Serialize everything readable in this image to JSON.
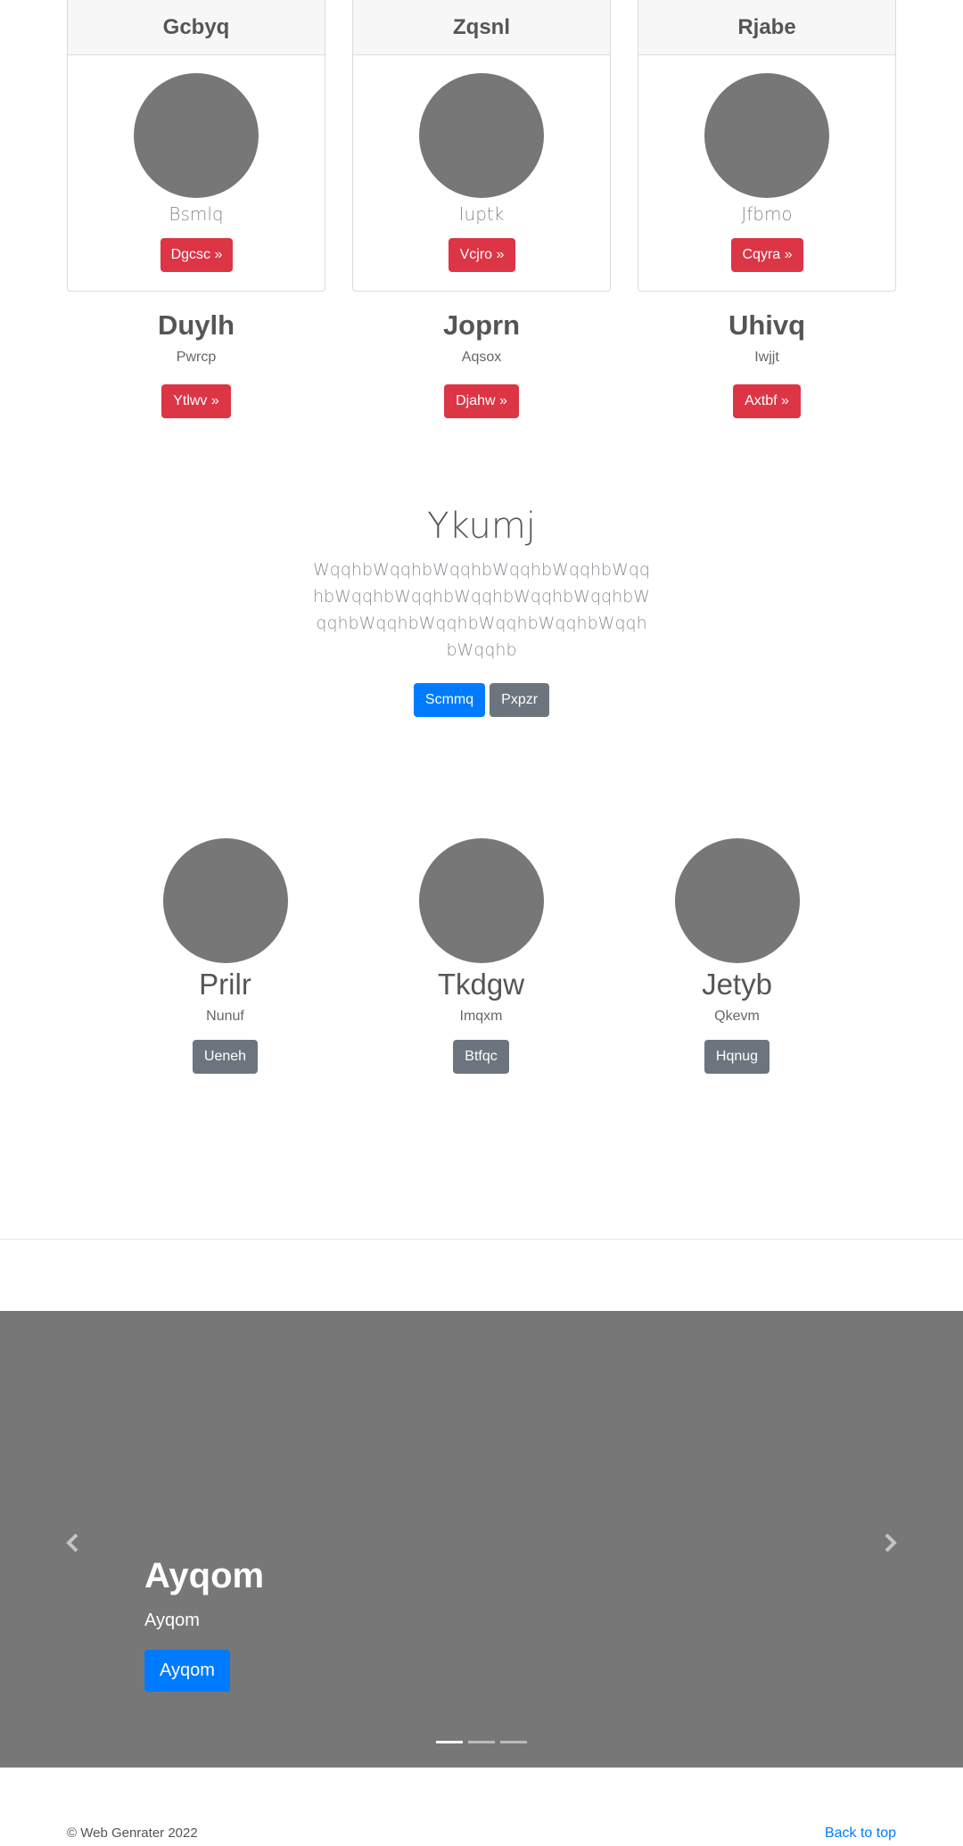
{
  "cards": [
    {
      "header": "Gcbyq",
      "name": "Bsmlq",
      "button": "Dgcsc »"
    },
    {
      "header": "Zqsnl",
      "name": "Iuptk",
      "button": "Vcjro »"
    },
    {
      "header": "Rjabe",
      "name": "Jfbmo",
      "button": "Cqyra »"
    }
  ],
  "features": [
    {
      "title": "Duylh",
      "subtitle": "Pwrcp",
      "button": "Ytlwv »"
    },
    {
      "title": "Joprn",
      "subtitle": "Aqsox",
      "button": "Djahw »"
    },
    {
      "title": "Uhivq",
      "subtitle": "Iwjjt",
      "button": "Axtbf »"
    }
  ],
  "hero": {
    "title": "Ykumj",
    "text": "WqqhbWqqhbWqqhbWqqhbWqqhbWqqhbWqqhbWqqhbWqqhbWqqhbWqqhbWqqhbWqqhbWqqhbWqqhbWqqhbWqqhbWqqhb",
    "primary_button": "Scmmq",
    "secondary_button": "Pxpzr"
  },
  "people": [
    {
      "name": "Prilr",
      "subtitle": "Nunuf",
      "button": "Ueneh"
    },
    {
      "name": "Tkdgw",
      "subtitle": "Imqxm",
      "button": "Btfqc"
    },
    {
      "name": "Jetyb",
      "subtitle": "Qkevm",
      "button": "Hqnug"
    }
  ],
  "carousel": {
    "title": "Ayqom",
    "subtitle": "Ayqom",
    "button": "Ayqom",
    "slide_count": 3,
    "active_slide": 0,
    "prev_icon": "chevron-left-icon",
    "next_icon": "chevron-right-icon"
  },
  "footer": {
    "copyright": "© Web Genrater 2022",
    "back_to_top": "Back to top"
  },
  "colors": {
    "danger": "#dc3545",
    "primary": "#007bff",
    "secondary": "#6c757d",
    "placeholder": "#777777"
  }
}
